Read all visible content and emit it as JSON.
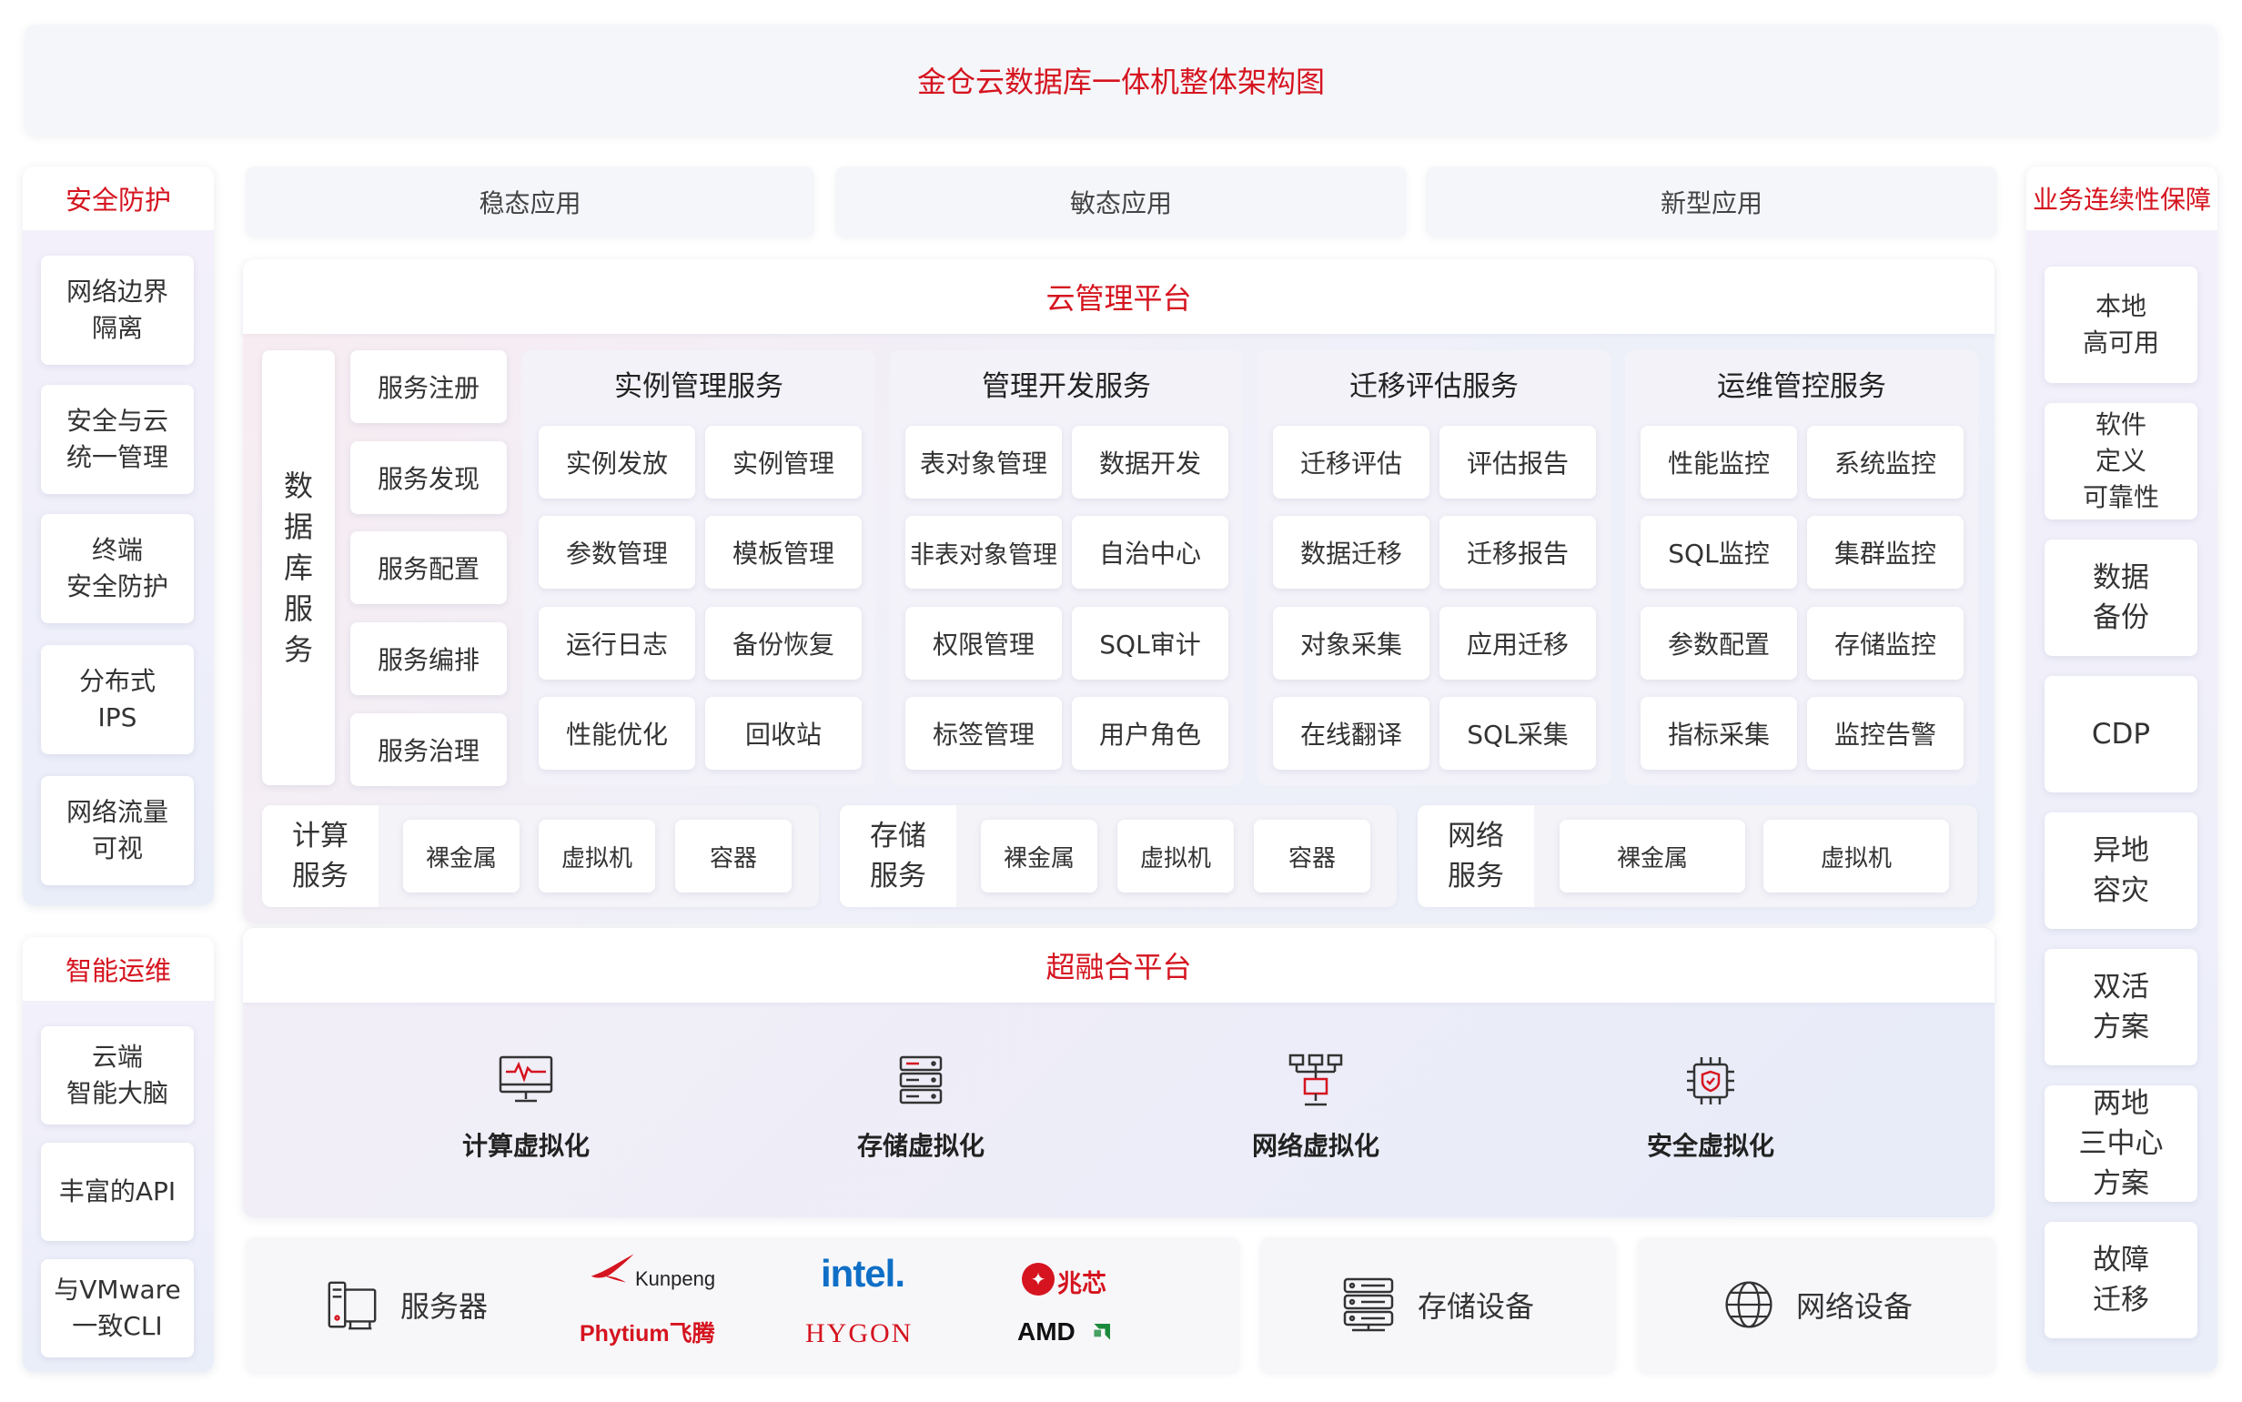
{
  "title": "金仓云数据库一体机整体架构图",
  "left": {
    "security": {
      "head": "安全防护",
      "items": [
        [
          "网络边界",
          "隔离"
        ],
        [
          "安全与云",
          "统一管理"
        ],
        [
          "终端",
          "安全防护"
        ],
        [
          "分布式",
          "IPS"
        ],
        [
          "网络流量",
          "可视"
        ]
      ]
    },
    "ops": {
      "head": "智能运维",
      "items": [
        [
          "云端",
          "智能大脑"
        ],
        [
          "丰富的API"
        ],
        [
          "与VMware",
          "一致CLI"
        ]
      ]
    }
  },
  "right": {
    "head": "业务连续性保障",
    "items": [
      [
        "本地",
        "高可用"
      ],
      [
        "软件",
        "定义",
        "可靠性"
      ],
      [
        "数据",
        "备份"
      ],
      [
        "CDP"
      ],
      [
        "异地",
        "容灾"
      ],
      [
        "双活",
        "方案"
      ],
      [
        "两地",
        "三中心",
        "方案"
      ],
      [
        "故障",
        "迁移"
      ]
    ]
  },
  "apps": [
    "稳态应用",
    "敏态应用",
    "新型应用"
  ],
  "cloud": {
    "head": "云管理平台",
    "db_service_chars": [
      "数",
      "据",
      "库",
      "服",
      "务"
    ],
    "db_service_items": [
      "服务注册",
      "服务发现",
      "服务配置",
      "服务编排",
      "服务治理"
    ],
    "groups": [
      {
        "title": "实例管理服务",
        "cells": [
          "实例发放",
          "实例管理",
          "参数管理",
          "模板管理",
          "运行日志",
          "备份恢复",
          "性能优化",
          "回收站"
        ]
      },
      {
        "title": "管理开发服务",
        "cells": [
          "表对象管理",
          "数据开发",
          "非表对象管理",
          "自治中心",
          "权限管理",
          "SQL审计",
          "标签管理",
          "用户角色"
        ]
      },
      {
        "title": "迁移评估服务",
        "cells": [
          "迁移评估",
          "评估报告",
          "数据迁移",
          "迁移报告",
          "对象采集",
          "应用迁移",
          "在线翻译",
          "SQL采集"
        ]
      },
      {
        "title": "运维管控服务",
        "cells": [
          "性能监控",
          "系统监控",
          "SQL监控",
          "集群监控",
          "参数配置",
          "存储监控",
          "指标采集",
          "监控告警"
        ]
      }
    ],
    "infra": [
      {
        "label": [
          "计算",
          "服务"
        ],
        "items": [
          "裸金属",
          "虚拟机",
          "容器"
        ]
      },
      {
        "label": [
          "存储",
          "服务"
        ],
        "items": [
          "裸金属",
          "虚拟机",
          "容器"
        ]
      },
      {
        "label": [
          "网络",
          "服务"
        ],
        "items": [
          "裸金属",
          "虚拟机"
        ]
      }
    ]
  },
  "hyper": {
    "head": "超融合平台",
    "items": [
      {
        "label": "计算虚拟化",
        "icon": "monitor-pulse-icon"
      },
      {
        "label": "存储虚拟化",
        "icon": "storage-stack-icon"
      },
      {
        "label": "网络虚拟化",
        "icon": "network-topology-icon"
      },
      {
        "label": "安全虚拟化",
        "icon": "security-chip-icon"
      }
    ]
  },
  "hardware": {
    "server": "服务器",
    "brands": {
      "kunpeng": "Kunpeng",
      "phytium": "Phytium飞腾",
      "intel": "intel.",
      "hygon": "HYGON",
      "zhaoxin": "兆芯",
      "amd": "AMD"
    },
    "storage": "存储设备",
    "network": "网络设备"
  },
  "colors": {
    "accent": "#d5141f",
    "intel": "#0f6fc6",
    "amd_arrow": "#1c8a3c"
  }
}
